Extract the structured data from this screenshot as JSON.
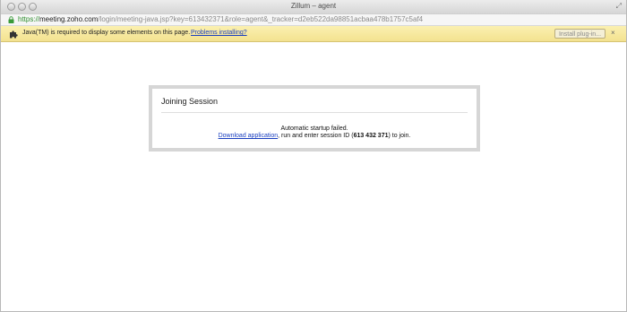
{
  "window": {
    "title": "Zillum – agent"
  },
  "address_bar": {
    "scheme": "https://",
    "host": "meeting.zoho.com",
    "path": "/login/meeting-java.jsp?key=613432371&role=agent&_tracker=d2eb522da98851acbaa478b1757c5af4"
  },
  "info_bar": {
    "message": "Java(TM) is required to display some elements on this page.",
    "link": "Problems installing?",
    "install_button": "Install plug-in...",
    "close_symbol": "×"
  },
  "dialog": {
    "title": "Joining Session",
    "line1": "Automatic startup failed.",
    "download_link": "Download application",
    "line2_mid": ", run and enter session ID (",
    "session_id": "613 432 371",
    "line2_end": ") to join."
  },
  "icons": {
    "lock": "lock-icon",
    "plugin": "puzzle-piece-icon",
    "resize": "fullscreen-icon"
  },
  "colors": {
    "infobar": "#f8eaa4",
    "link": "#1a3fbf",
    "secure": "#2f8f2f"
  }
}
